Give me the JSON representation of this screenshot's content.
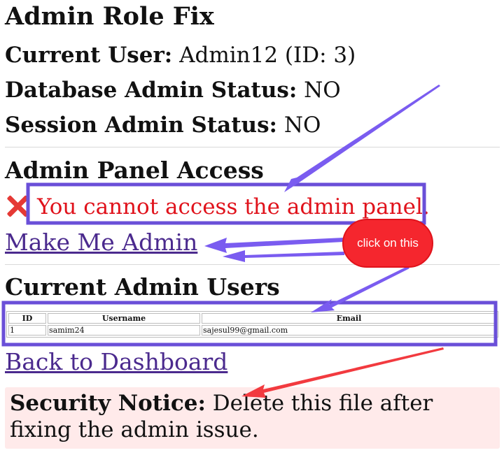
{
  "page": {
    "title": "Admin Role Fix"
  },
  "user_info": {
    "current_user_label": "Current User:",
    "current_user_value": "Admin12 (ID: 3)",
    "db_status_label": "Database Admin Status:",
    "db_status_value": "NO",
    "session_status_label": "Session Admin Status:",
    "session_status_value": "NO"
  },
  "admin_panel": {
    "heading": "Admin Panel Access",
    "denied_message": "You cannot access the admin panel.",
    "make_admin_link": "Make Me Admin"
  },
  "admin_users": {
    "heading": "Current Admin Users",
    "columns": [
      "ID",
      "Username",
      "Email"
    ],
    "rows": [
      {
        "id": "1",
        "username": "samim24",
        "email": "sajesul99@gmail.com"
      }
    ]
  },
  "back_link": "Back to Dashboard",
  "notice": {
    "label": "Security Notice:",
    "text": "Delete this file after fixing the admin issue."
  },
  "annotation": {
    "callout": "click on this",
    "box_color": "#6a4fd8",
    "arrow_purple": "#7a5cf0",
    "arrow_red": "#f23a3f"
  },
  "colors": {
    "error": "#e0121b",
    "link": "#4b2a8e",
    "notice_bg": "#ffeaea"
  },
  "icons": {
    "denied": "cross-mark-icon"
  }
}
